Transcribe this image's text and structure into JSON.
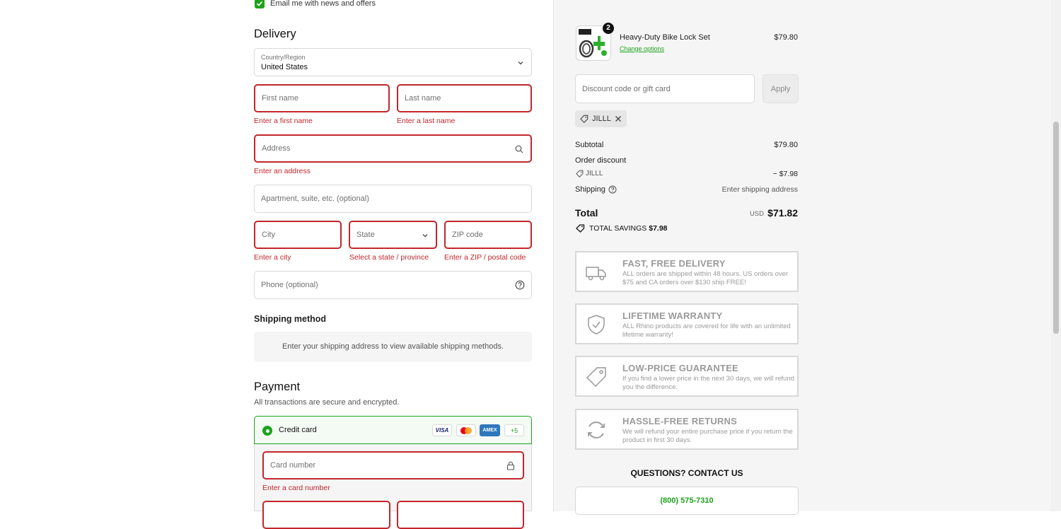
{
  "contact": {
    "email_opt_in_label": "Email me with news and offers"
  },
  "delivery": {
    "heading": "Delivery",
    "country_label": "Country/Region",
    "country_value": "United States",
    "first_name_placeholder": "First name",
    "first_name_error": "Enter a first name",
    "last_name_placeholder": "Last name",
    "last_name_error": "Enter a last name",
    "address_placeholder": "Address",
    "address_error": "Enter an address",
    "apartment_placeholder": "Apartment, suite, etc. (optional)",
    "city_placeholder": "City",
    "city_error": "Enter a city",
    "state_placeholder": "State",
    "state_error": "Select a state / province",
    "zip_placeholder": "ZIP code",
    "zip_error": "Enter a ZIP / postal code",
    "phone_placeholder": "Phone (optional)"
  },
  "shipping_method": {
    "heading": "Shipping method",
    "message": "Enter your shipping address to view available shipping methods."
  },
  "payment": {
    "heading": "Payment",
    "subtext": "All transactions are secure and encrypted.",
    "method_label": "Credit card",
    "card_brands": [
      "VISA",
      "MC",
      "AMEX"
    ],
    "more_brands": "+5",
    "card_number_placeholder": "Card number",
    "card_number_error": "Enter a card number"
  },
  "order": {
    "item": {
      "name": "Heavy-Duty Bike Lock Set",
      "change_options": "Change options",
      "price": "$79.80",
      "quantity": "2"
    },
    "discount_placeholder": "Discount code or gift card",
    "apply_label": "Apply",
    "applied_code": "JILLL",
    "subtotal_label": "Subtotal",
    "subtotal_value": "$79.80",
    "order_discount_label": "Order discount",
    "discount_code": "JILLL",
    "discount_value": "− $7.98",
    "shipping_label": "Shipping",
    "shipping_value": "Enter shipping address",
    "total_label": "Total",
    "currency": "USD",
    "total_value": "$71.82",
    "savings_label": "TOTAL SAVINGS",
    "savings_value": "$7.98"
  },
  "promos": [
    {
      "title": "FAST, FREE DELIVERY",
      "desc": "ALL orders are shipped within 48 hours. US orders over $75 and CA orders over $130 ship FREE!"
    },
    {
      "title": "LIFETIME WARRANTY",
      "desc": "ALL Rhino products are covered for life with an unlimited lifetime warranty!"
    },
    {
      "title": "LOW-PRICE GUARANTEE",
      "desc": "If you find a lower price in the next 30 days, we will refund you the difference."
    },
    {
      "title": "HASSLE-FREE RETURNS",
      "desc": "We will refund your entire purchase price if you return the product in first 30 days."
    }
  ],
  "contact_us": {
    "heading": "QUESTIONS? CONTACT US",
    "phone": "(800) 575-7310"
  },
  "colors": {
    "accent": "#1ba31b",
    "error": "#c2262b",
    "sidebar_bg": "#f5f5f5"
  }
}
